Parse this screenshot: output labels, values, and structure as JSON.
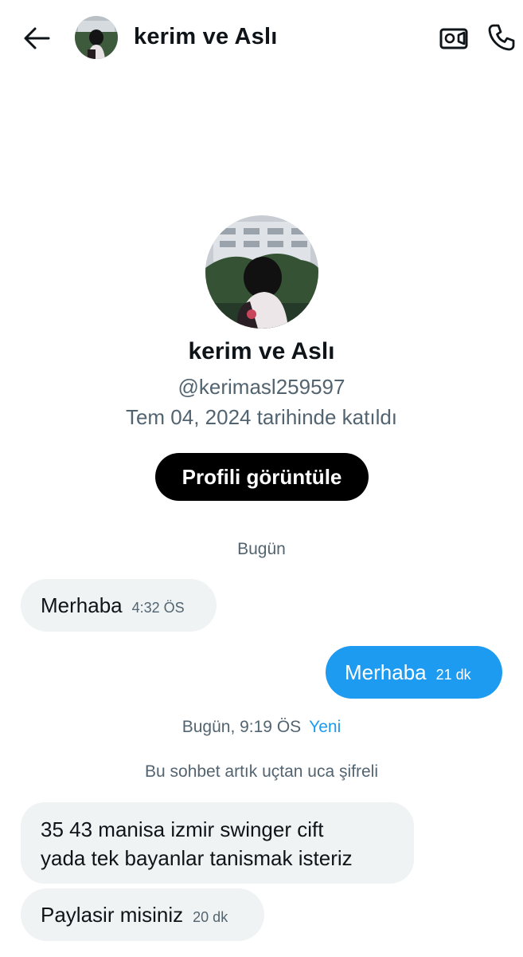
{
  "header": {
    "title": "kerim ve Aslı",
    "back_icon": "arrow-left-icon",
    "video_icon": "video-camera-icon",
    "call_icon": "phone-icon"
  },
  "profile": {
    "name": "kerim ve Aslı",
    "handle": "@kerimasl259597",
    "joined": "Tem 04, 2024 tarihinde katıldı",
    "view_button": "Profili görüntüle"
  },
  "conversation": {
    "day_label": "Bugün",
    "messages_before": [
      {
        "direction": "in",
        "text": "Merhaba",
        "time": "4:32 ÖS"
      },
      {
        "direction": "out",
        "text": "Merhaba",
        "time": "21 dk"
      }
    ],
    "separator": {
      "label": "Bugün, 9:19 ÖS",
      "new_label": "Yeni"
    },
    "encryption_note": "Bu sohbet artık uçtan uca şifreli",
    "messages_after": [
      {
        "direction": "in",
        "line1": "35 43 manisa izmir swinger cift",
        "line2": "yada tek bayanlar tanismak isteriz"
      },
      {
        "direction": "in",
        "text": "Paylasir misiniz",
        "time": "20 dk"
      }
    ]
  },
  "colors": {
    "accent": "#1d9bf0",
    "incoming_bubble": "#eff3f4",
    "secondary_text": "#536471",
    "button_bg": "#000000"
  }
}
